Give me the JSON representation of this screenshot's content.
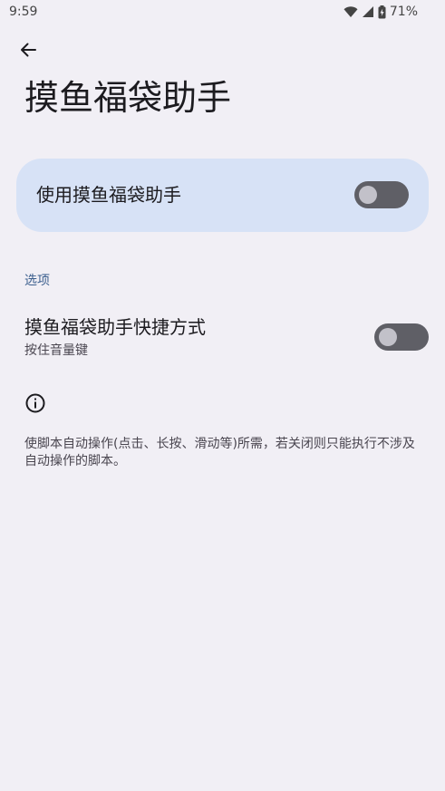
{
  "status_bar": {
    "time": "9:59",
    "battery_percent": "71%",
    "icons": [
      "wifi-icon",
      "cellular-signal-icon",
      "battery-icon"
    ]
  },
  "header": {
    "back_icon": "arrow-back-icon",
    "title": "摸鱼福袋助手"
  },
  "main_switch": {
    "label": "使用摸鱼福袋助手",
    "enabled": false
  },
  "options": {
    "section_title": "选项",
    "shortcut": {
      "title": "摸鱼福袋助手快捷方式",
      "summary": "按住音量键",
      "enabled": false
    }
  },
  "info": {
    "icon": "info-icon",
    "text": "使脚本自动操作(点击、长按、滑动等)所需，若关闭则只能执行不涉及自动操作的脚本。"
  },
  "colors": {
    "background": "#f1eff5",
    "card": "#d7e2f6",
    "toggle_track": "#5f5f66",
    "toggle_knob": "#c2c1c9",
    "accent": "#3c5f8e"
  }
}
